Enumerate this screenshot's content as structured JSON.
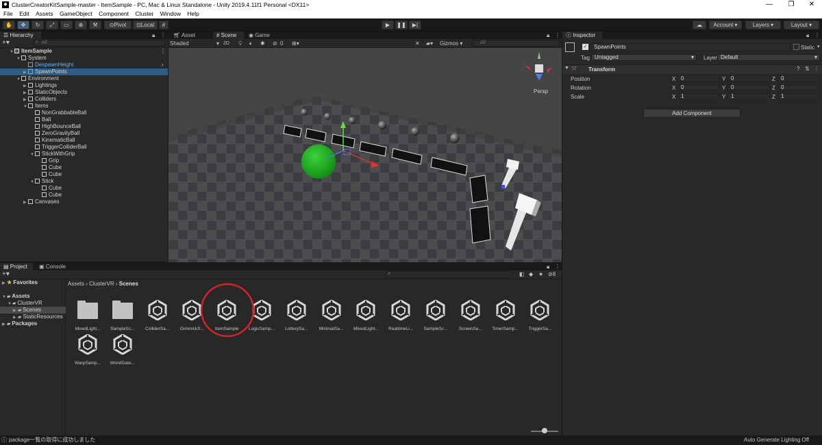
{
  "window": {
    "title": "ClusterCreatorKitSample-master - ItemSample - PC, Mac & Linux Standalone - Unity 2019.4.11f1 Personal <DX11>",
    "controls": [
      "—",
      "❐",
      "✕"
    ]
  },
  "menu": [
    "File",
    "Edit",
    "Assets",
    "GameObject",
    "Component",
    "Cluster",
    "Window",
    "Help"
  ],
  "toolbar": {
    "pivot_label": "Pivot",
    "local_label": "Local",
    "account_label": "Account",
    "layers_label": "Layers",
    "layout_label": "Layout"
  },
  "hierarchy": {
    "tab": "Hierarchy",
    "search_placeholder": "All",
    "rows": [
      {
        "label": "ItemSample",
        "depth": 0,
        "arrow": "▼",
        "icon": "scene"
      },
      {
        "label": "System",
        "depth": 1,
        "arrow": "▼",
        "icon": "cube"
      },
      {
        "label": "DespawnHeight",
        "depth": 2,
        "arrow": "",
        "icon": "cube-blue"
      },
      {
        "label": "SpawnPoints",
        "depth": 2,
        "arrow": "▶",
        "icon": "cube-blue"
      },
      {
        "label": "Environment",
        "depth": 1,
        "arrow": "▼",
        "icon": "cube"
      },
      {
        "label": "Lightings",
        "depth": 2,
        "arrow": "▶",
        "icon": "cube"
      },
      {
        "label": "StaticObjects",
        "depth": 2,
        "arrow": "▶",
        "icon": "cube"
      },
      {
        "label": "Colliders",
        "depth": 2,
        "arrow": "▶",
        "icon": "cube"
      },
      {
        "label": "Items",
        "depth": 2,
        "arrow": "▼",
        "icon": "cube"
      },
      {
        "label": "NonGrabbableBall",
        "depth": 3,
        "arrow": "",
        "icon": "cube"
      },
      {
        "label": "Ball",
        "depth": 3,
        "arrow": "",
        "icon": "cube"
      },
      {
        "label": "HighBounceBall",
        "depth": 3,
        "arrow": "",
        "icon": "cube"
      },
      {
        "label": "ZeroGravityBall",
        "depth": 3,
        "arrow": "",
        "icon": "cube"
      },
      {
        "label": "KinematicBall",
        "depth": 3,
        "arrow": "",
        "icon": "cube"
      },
      {
        "label": "TriggerColliderBall",
        "depth": 3,
        "arrow": "",
        "icon": "cube"
      },
      {
        "label": "StickWithGrip",
        "depth": 3,
        "arrow": "▼",
        "icon": "cube"
      },
      {
        "label": "Grip",
        "depth": 4,
        "arrow": "",
        "icon": "cube"
      },
      {
        "label": "Cube",
        "depth": 4,
        "arrow": "",
        "icon": "cube"
      },
      {
        "label": "Cube",
        "depth": 4,
        "arrow": "",
        "icon": "cube"
      },
      {
        "label": "Stick",
        "depth": 3,
        "arrow": "▼",
        "icon": "cube"
      },
      {
        "label": "Cube",
        "depth": 4,
        "arrow": "",
        "icon": "cube"
      },
      {
        "label": "Cube",
        "depth": 4,
        "arrow": "",
        "icon": "cube"
      },
      {
        "label": "Canvases",
        "depth": 2,
        "arrow": "▶",
        "icon": "cube"
      }
    ]
  },
  "scene": {
    "tabs": [
      "Asset Store",
      "Scene",
      "Game"
    ],
    "shading_mode": "Shaded",
    "mode_2d": "2D",
    "hidden_count": "0",
    "gizmos_label": "Gizmos",
    "search_placeholder": "All",
    "persp_label": "Persp"
  },
  "project": {
    "tabs": [
      "Project",
      "Console"
    ],
    "favorites_label": "Favorites",
    "tree": [
      {
        "label": "Assets",
        "arrow": "▼",
        "depth": 0
      },
      {
        "label": "ClusterVR",
        "arrow": "▼",
        "depth": 1
      },
      {
        "label": "Scenes",
        "arrow": "▶",
        "depth": 2
      },
      {
        "label": "StaticResources",
        "arrow": "▶",
        "depth": 2
      },
      {
        "label": "Packages",
        "arrow": "▶",
        "depth": 0
      }
    ],
    "breadcrumb": [
      "Assets",
      "ClusterVR",
      "Scenes"
    ],
    "hidden_packages_count": "8",
    "assets": [
      {
        "label": "MixedLight...",
        "type": "folder"
      },
      {
        "label": "SampleSc...",
        "type": "folder"
      },
      {
        "label": "ColliderSa...",
        "type": "scene"
      },
      {
        "label": "GimmickS...",
        "type": "scene"
      },
      {
        "label": "ItemSample",
        "type": "scene"
      },
      {
        "label": "LogicSamp...",
        "type": "scene"
      },
      {
        "label": "LotterySa...",
        "type": "scene"
      },
      {
        "label": "MinimalSa...",
        "type": "scene"
      },
      {
        "label": "MixedLight...",
        "type": "scene"
      },
      {
        "label": "RealtimeLi...",
        "type": "scene"
      },
      {
        "label": "SampleSc...",
        "type": "scene"
      },
      {
        "label": "ScreenSa...",
        "type": "scene"
      },
      {
        "label": "TimerSamp...",
        "type": "scene"
      },
      {
        "label": "TriggerSa...",
        "type": "scene"
      },
      {
        "label": "WarpSamp...",
        "type": "scene"
      },
      {
        "label": "WorldGate...",
        "type": "scene"
      }
    ],
    "highlight_color": "#d4242a"
  },
  "inspector": {
    "tab": "Inspector",
    "object_name": "SpawnPoints",
    "static_label": "Static",
    "tag_label": "Tag",
    "tag_value": "Untagged",
    "layer_label": "Layer",
    "layer_value": "Default",
    "component_name": "Transform",
    "rows": [
      {
        "label": "Position",
        "x": "0",
        "y": "0",
        "z": "0"
      },
      {
        "label": "Rotation",
        "x": "0",
        "y": "0",
        "z": "0"
      },
      {
        "label": "Scale",
        "x": "1",
        "y": "1",
        "z": "1"
      }
    ],
    "axis_labels": [
      "X",
      "Y",
      "Z"
    ],
    "add_component_label": "Add Component"
  },
  "status": {
    "message": "package一覧の取得に成功しました",
    "right": "Auto Generate Lighting Off"
  },
  "colors": {
    "selection": "#2c5d87",
    "accent_blue": "#5fa9e8",
    "ball_green": "#2fae2f"
  }
}
